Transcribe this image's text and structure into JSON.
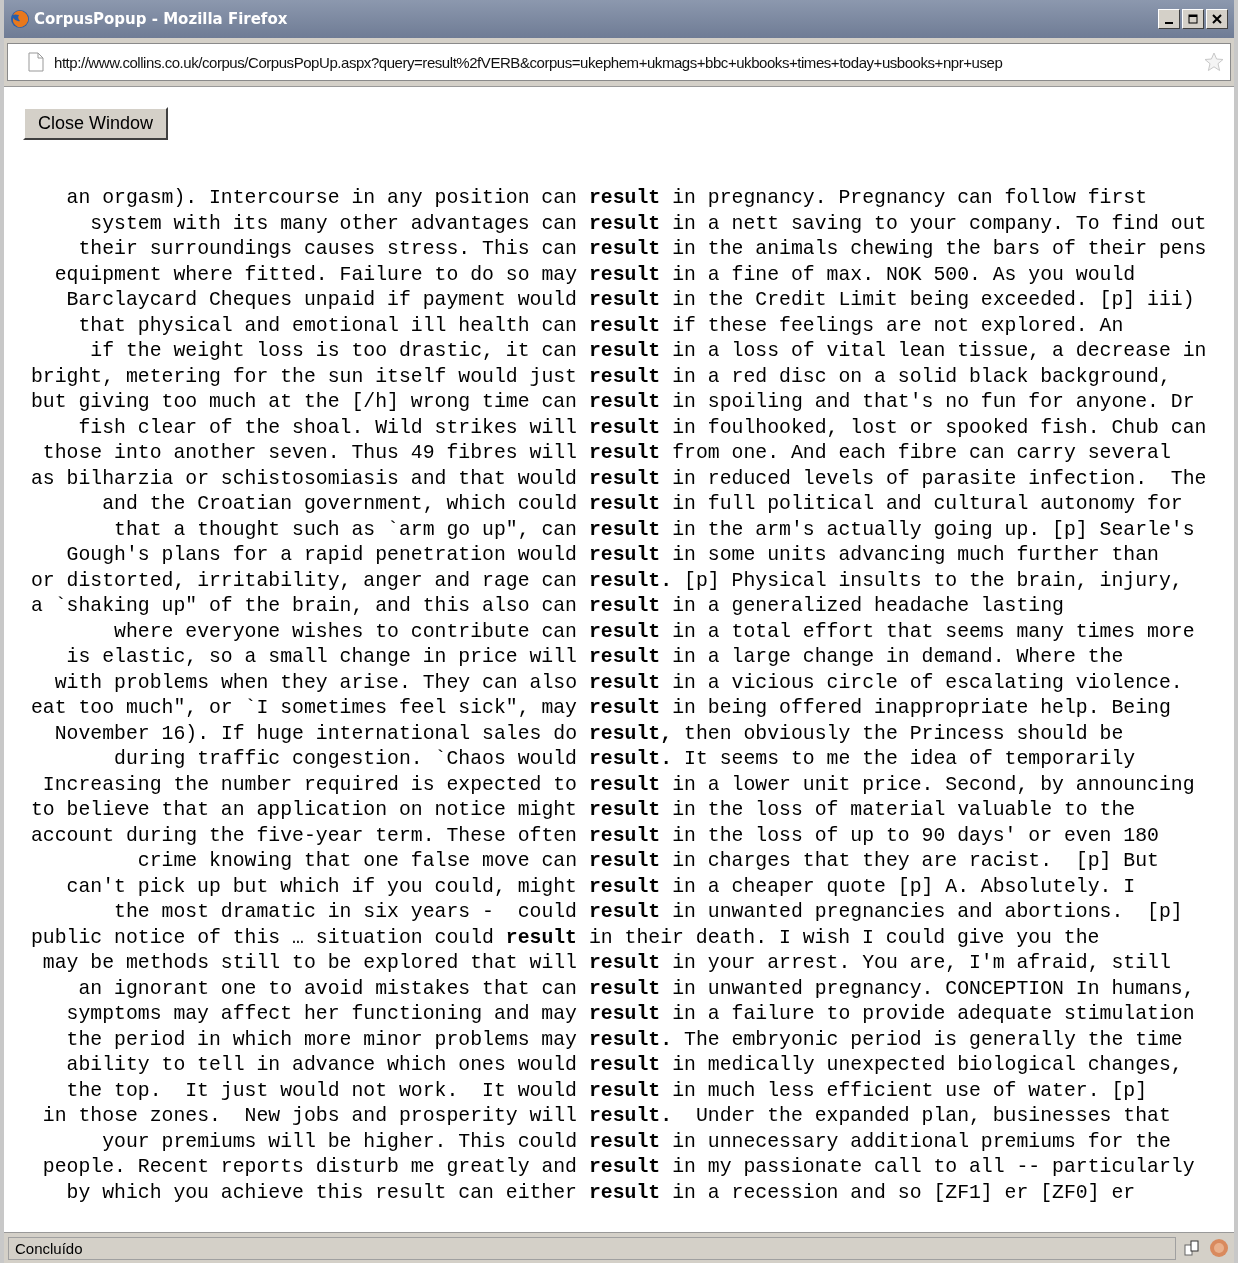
{
  "window": {
    "title": "CorpusPopup - Mozilla Firefox"
  },
  "address_bar": {
    "url": "http://www.collins.co.uk/corpus/CorpusPopUp.aspx?query=result%2fVERB&corpus=ukephem+ukmags+bbc+ukbooks+times+today+usbooks+npr+usep"
  },
  "close_button": {
    "label": "Close Window"
  },
  "concordance": [
    {
      "left": "an orgasm). Intercourse in any position can",
      "keyword": "result",
      "right": "in pregnancy. Pregnancy can follow first"
    },
    {
      "left": "system with its many other advantages can",
      "keyword": "result",
      "right": "in a nett saving to your company. To find out"
    },
    {
      "left": "their surroundings causes stress. This can",
      "keyword": "result",
      "right": "in the animals chewing the bars of their pens"
    },
    {
      "left": "equipment where fitted. Failure to do so may",
      "keyword": "result",
      "right": "in a fine of max. NOK 500. As you would"
    },
    {
      "left": "Barclaycard Cheques unpaid if payment would",
      "keyword": "result",
      "right": "in the Credit Limit being exceeded. [p] iii)"
    },
    {
      "left": "that physical and emotional ill health can",
      "keyword": "result",
      "right": "if these feelings are not explored. An"
    },
    {
      "left": "if the weight loss is too drastic, it can",
      "keyword": "result",
      "right": "in a loss of vital lean tissue, a decrease in"
    },
    {
      "left": "bright, metering for the sun itself would just",
      "keyword": "result",
      "right": "in a red disc on a solid black background,"
    },
    {
      "left": "but giving too much at the [/h] wrong time can",
      "keyword": "result",
      "right": "in spoiling and that's no fun for anyone. Dr"
    },
    {
      "left": "fish clear of the shoal. Wild strikes will",
      "keyword": "result",
      "right": "in foulhooked, lost or spooked fish. Chub can"
    },
    {
      "left": "those into another seven. Thus 49 fibres will",
      "keyword": "result",
      "right": "from one. And each fibre can carry several"
    },
    {
      "left": "as bilharzia or schistosomiasis and that would",
      "keyword": "result",
      "right": "in reduced levels of parasite infection.  The"
    },
    {
      "left": "and the Croatian government, which could",
      "keyword": "result",
      "right": "in full political and cultural autonomy for"
    },
    {
      "left": "that a thought such as `arm go up\", can",
      "keyword": "result",
      "right": "in the arm's actually going up. [p] Searle's"
    },
    {
      "left": "Gough's plans for a rapid penetration would",
      "keyword": "result",
      "right": "in some units advancing much further than"
    },
    {
      "left": "or distorted, irritability, anger and rage can",
      "keyword": "result.",
      "right": "[p] Physical insults to the brain, injury,"
    },
    {
      "left": "a `shaking up\" of the brain, and this also can",
      "keyword": "result",
      "right": "in a generalized headache lasting"
    },
    {
      "left": "where everyone wishes to contribute can",
      "keyword": "result",
      "right": "in a total effort that seems many times more"
    },
    {
      "left": "is elastic, so a small change in price will",
      "keyword": "result",
      "right": "in a large change in demand. Where the"
    },
    {
      "left": "with problems when they arise. They can also",
      "keyword": "result",
      "right": "in a vicious circle of escalating violence."
    },
    {
      "left": "eat too much\", or `I sometimes feel sick\", may",
      "keyword": "result",
      "right": "in being offered inappropriate help. Being"
    },
    {
      "left": "November 16). If huge international sales do",
      "keyword": "result,",
      "right": "then obviously the Princess should be"
    },
    {
      "left": "during traffic congestion. `Chaos would",
      "keyword": "result.",
      "right": "It seems to me the idea of temporarily"
    },
    {
      "left": "Increasing the number required is expected to",
      "keyword": "result",
      "right": "in a lower unit price. Second, by announcing"
    },
    {
      "left": "to believe that an application on notice might",
      "keyword": "result",
      "right": "in the loss of material valuable to the"
    },
    {
      "left": "account during the five-year term. These often",
      "keyword": "result",
      "right": "in the loss of up to 90 days' or even 180"
    },
    {
      "left": "crime knowing that one false move can",
      "keyword": "result",
      "right": "in charges that they are racist.  [p] But"
    },
    {
      "left": "can't pick up but which if you could, might",
      "keyword": "result",
      "right": "in a cheaper quote [p] A. Absolutely. I"
    },
    {
      "left": "the most dramatic in six years -  could",
      "keyword": "result",
      "right": "in unwanted pregnancies and abortions.  [p]"
    },
    {
      "left": "public notice of this … situation could **result**",
      "right": "in their death. I wish I could give you the"
    },
    {
      "left": "may be methods still to be explored that will",
      "keyword": "result",
      "right": "in your arrest. You are, I'm afraid, still"
    },
    {
      "left": "an ignorant one to avoid mistakes that can",
      "keyword": "result",
      "right": "in unwanted pregnancy. CONCEPTION In humans,"
    },
    {
      "left": "symptoms may affect her functioning and may",
      "keyword": "result",
      "right": "in a failure to provide adequate stimulation"
    },
    {
      "left": "the period in which more minor problems may",
      "keyword": "result.",
      "right": "The embryonic period is generally the time"
    },
    {
      "left": "ability to tell in advance which ones would",
      "keyword": "result",
      "right": "in medically unexpected biological changes,"
    },
    {
      "left": "the top.  It just would not work.  It would",
      "keyword": "result",
      "right": "in much less efficient use of water. [p]"
    },
    {
      "left": "in those zones.  New jobs and prosperity will",
      "keyword": "result.",
      "right": " Under the expanded plan, businesses that"
    },
    {
      "left": "your premiums will be higher. This could",
      "keyword": "result",
      "right": "in unnecessary additional premiums for the"
    },
    {
      "left": "people. Recent reports disturb me greatly and",
      "keyword": "result",
      "right": "in my passionate call to all -- particularly"
    },
    {
      "left": "by which you achieve this result can either",
      "keyword": "result",
      "right": "in a recession and so [ZF1] er [ZF0] er"
    }
  ],
  "status_bar": {
    "text": "Concluído"
  }
}
